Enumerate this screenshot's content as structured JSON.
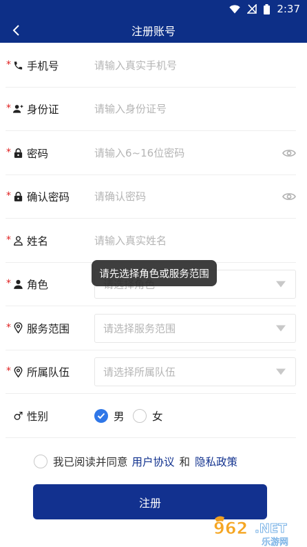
{
  "status_bar": {
    "time": "2:37"
  },
  "header": {
    "title": "注册账号",
    "back_icon": "chevron-left-icon"
  },
  "form": {
    "required_mark": "*",
    "phone": {
      "label": "手机号",
      "placeholder": "请输入真实手机号",
      "icon": "phone-icon"
    },
    "id_card": {
      "label": "身份证",
      "placeholder": "请输入身份证号",
      "icon": "person-add-icon"
    },
    "password": {
      "label": "密码",
      "placeholder": "请输入6~16位密码",
      "icon": "lock-icon"
    },
    "confirm_password": {
      "label": "确认密码",
      "placeholder": "请确认密码",
      "icon": "lock-icon"
    },
    "name": {
      "label": "姓名",
      "placeholder": "请输入真实姓名",
      "icon": "person-outline-icon"
    },
    "role": {
      "label": "角色",
      "placeholder": "请选择角色",
      "icon": "person-icon"
    },
    "service_area": {
      "label": "服务范围",
      "placeholder": "请选择服务范围",
      "icon": "location-pin-icon"
    },
    "team": {
      "label": "所属队伍",
      "placeholder": "请选择所属队伍",
      "icon": "location-pin-icon"
    },
    "gender": {
      "label": "性别",
      "icon": "male-symbol-icon",
      "icon_glyph": "♂",
      "options": [
        "男",
        "女"
      ],
      "selected": "男"
    }
  },
  "agreement": {
    "prefix": "我已阅读并同意",
    "user_agreement": "用户协议",
    "and": "和",
    "privacy_policy": "隐私政策"
  },
  "submit_label": "注册",
  "toast": "请先选择角色或服务范围",
  "watermark": {
    "number": "962",
    "suffix": ".NET",
    "text": "乐游网"
  },
  "colors": {
    "primary": "#0d2f87",
    "button": "#12318f",
    "link": "#13338f",
    "required": "#e02020",
    "radio_on": "#2f77e8"
  }
}
